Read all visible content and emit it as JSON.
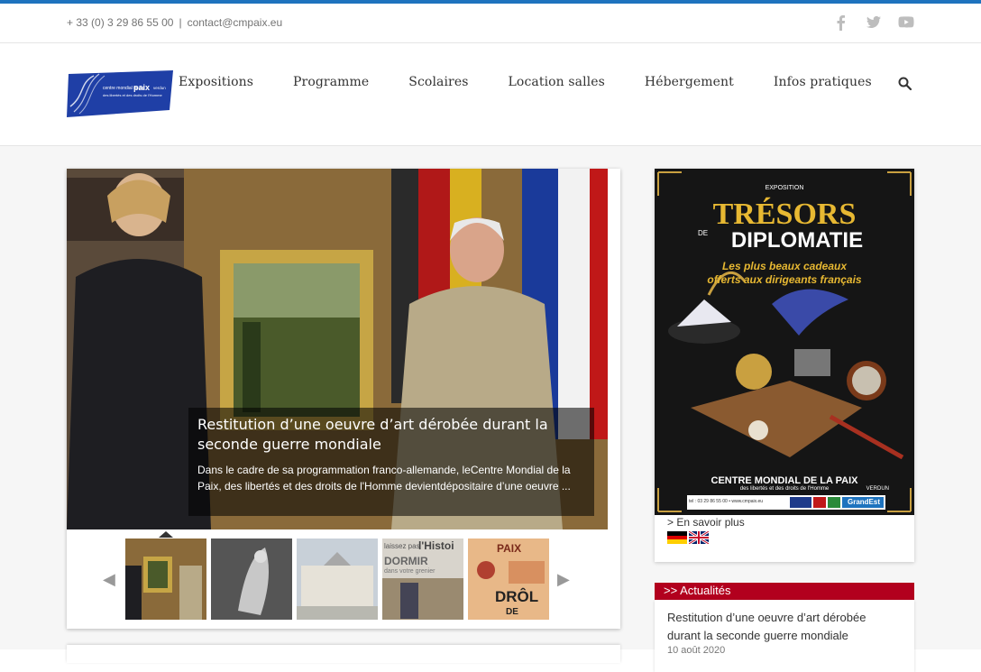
{
  "contact": {
    "phone": "+ 33 (0) 3 29 86 55 00",
    "separator": "|",
    "email": "contact@cmpaix.eu"
  },
  "social": [
    "facebook-icon",
    "twitter-icon",
    "youtube-icon"
  ],
  "colors": {
    "accent": "#1e73be",
    "news_header": "#b2001e",
    "logo_blue": "#1f3fa6"
  },
  "logo": {
    "line1": "centre mondial de la",
    "brand": "paix",
    "city": "verdun",
    "line2": "des libertés et des droits de l'Homme"
  },
  "nav": [
    "Expositions",
    "Programme",
    "Scolaires",
    "Location salles",
    "Hébergement",
    "Infos pratiques"
  ],
  "slider": {
    "title": "Restitution d’une oeuvre d’art dérobée durant la seconde guerre mondiale",
    "text": "Dans le cadre de sa programmation franco-allemande, leCentre Mondial de la Paix, des libertés et des droits de l'Homme devientdépositaire d’une oeuvre ...",
    "prev": "◀",
    "next": "▶",
    "thumb_texts": {
      "t4_a": "laissez pas",
      "t4_b": "l'Histoi",
      "t4_c": "DORMIR",
      "t4_d": "dans votre grenier",
      "t5_a": "PAIX",
      "t5_b": "DRÔL",
      "t5_c": "DE"
    }
  },
  "poster": {
    "kicker": "EXPOSITION",
    "title1": "TRÉSORS",
    "de": "DE",
    "title2": "DIPLOMATIE",
    "subtitle1": "Les plus beaux cadeaux",
    "subtitle2": "offerts aux dirigeants français",
    "footer1": "CENTRE MONDIAL DE LA PAIX",
    "footer2": "des libertés et des droits de l'Homme",
    "footer_city": "VERDUN",
    "contact": "tel : 03 29 86 55 00 • www.cmpaix.eu",
    "sponsor": "GrandEst"
  },
  "sidebar": {
    "more_link": "> En savoir plus"
  },
  "news": {
    "header": ">> Actualités",
    "item_title": "Restitution d’une oeuvre d’art dérobée durant la seconde guerre mondiale",
    "item_date": "10 août 2020"
  }
}
